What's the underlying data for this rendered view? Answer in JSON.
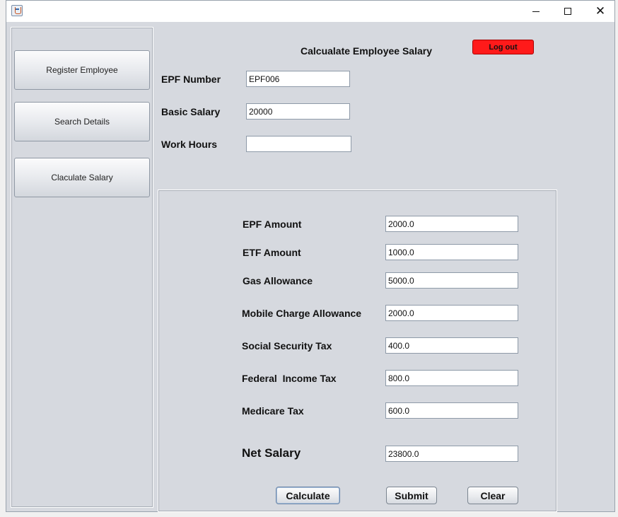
{
  "window": {
    "icon": "java-icon",
    "minimize_icon": "minimize-icon",
    "maximize_icon": "maximize-icon",
    "close_icon": "close-icon",
    "close_glyph": "✕"
  },
  "sidebar": {
    "items": [
      {
        "label": "Register Employee"
      },
      {
        "label": "Search Details"
      },
      {
        "label": "Claculate Salary"
      }
    ]
  },
  "header": {
    "title": "Calcualate Employee Salary",
    "logout_label": "Log out",
    "logout_color": "#ff1a1a"
  },
  "inputs": {
    "epf_number": {
      "label": "EPF Number",
      "value": "EPF006"
    },
    "basic_salary": {
      "label": "Basic Salary",
      "value": "20000"
    },
    "work_hours": {
      "label": "Work Hours",
      "value": ""
    }
  },
  "results": [
    {
      "label": "EPF Amount",
      "value": "2000.0"
    },
    {
      "label": "ETF Amount",
      "value": "1000.0"
    },
    {
      "label": "Gas Allowance",
      "value": "5000.0"
    },
    {
      "label": "Mobile Charge Allowance",
      "value": "2000.0"
    },
    {
      "label": "Social Security Tax",
      "value": "400.0"
    },
    {
      "label": "Federal  Income Tax",
      "value": "800.0"
    },
    {
      "label": "Medicare Tax",
      "value": "600.0"
    }
  ],
  "net_salary": {
    "label": "Net Salary",
    "value": "23800.0"
  },
  "actions": {
    "calculate": "Calculate",
    "submit": "Submit",
    "clear": "Clear"
  }
}
